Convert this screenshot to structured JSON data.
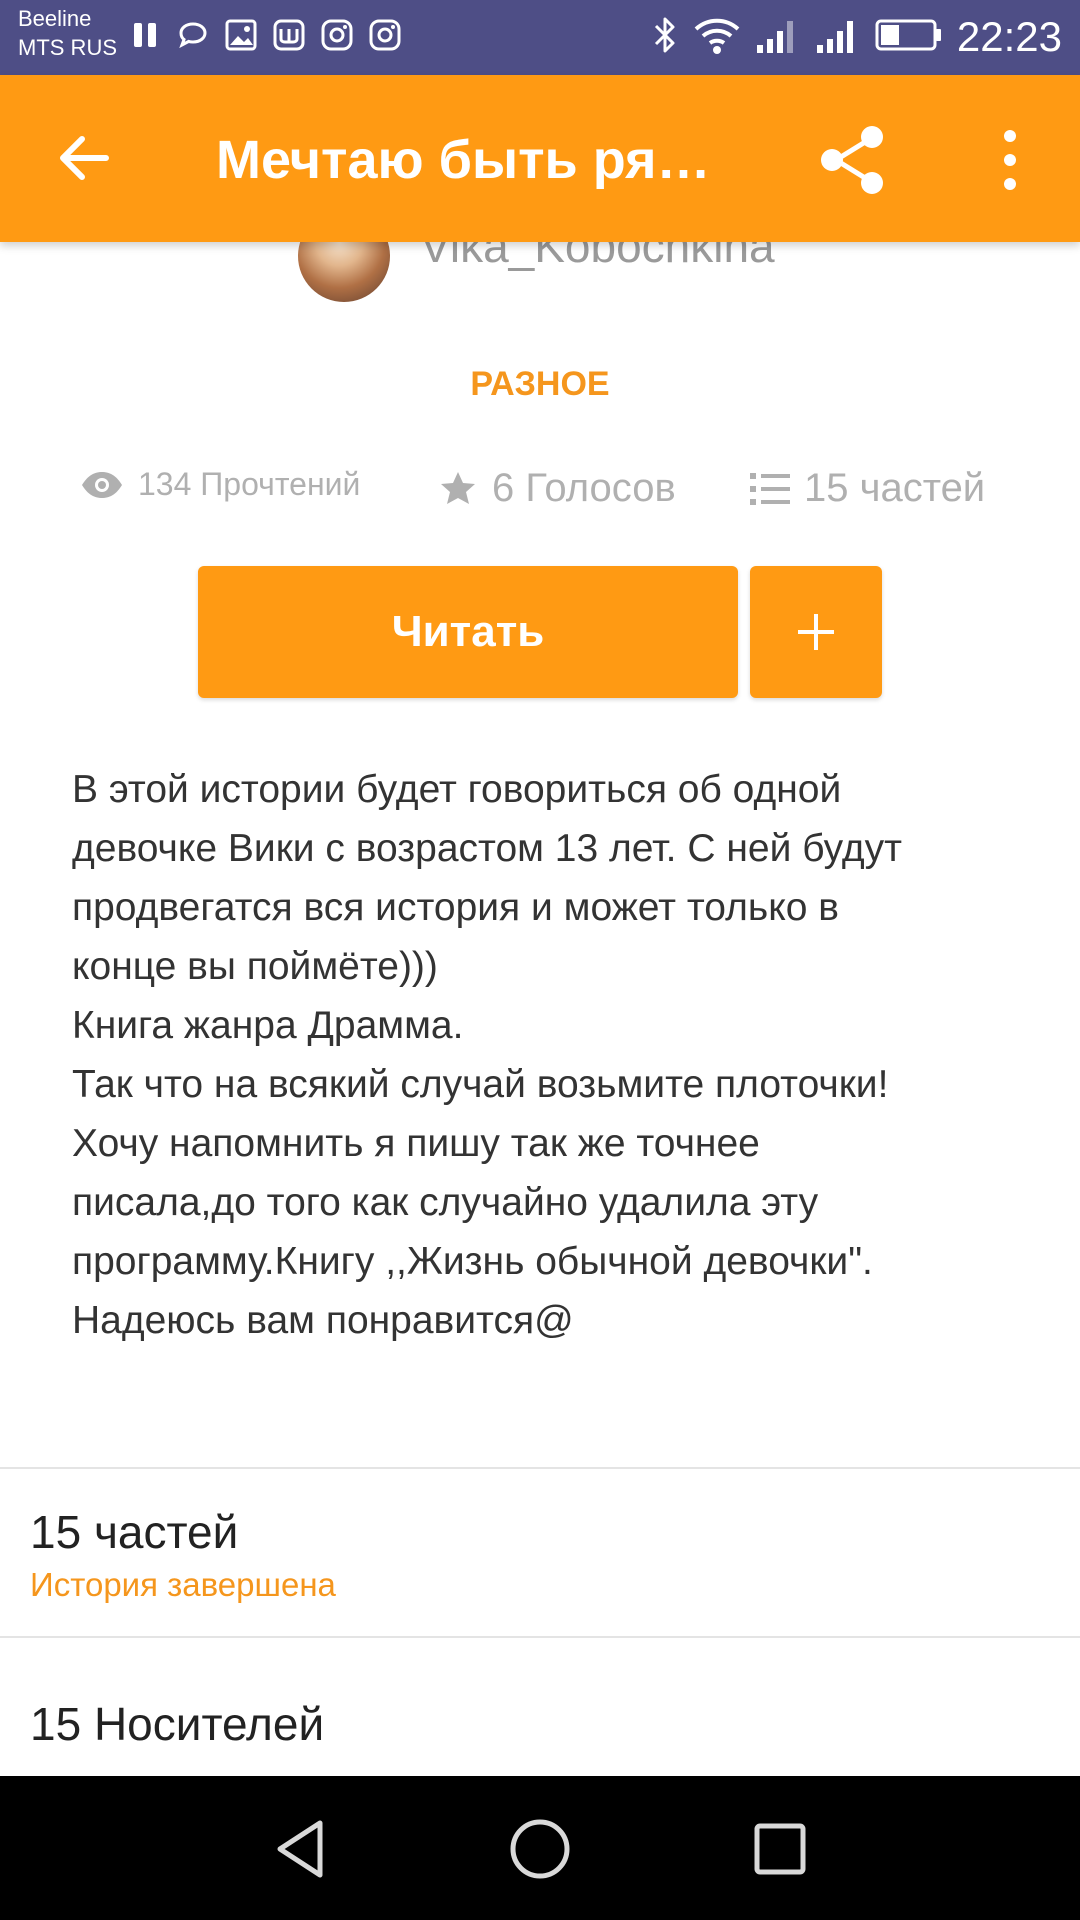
{
  "status_bar": {
    "carrier1": "Beeline",
    "carrier2": "MTS RUS",
    "time": "22:23",
    "left_icons": [
      "pause-icon",
      "chat-icon",
      "gallery-icon",
      "app-icon",
      "instagram-icon",
      "instagram-icon"
    ],
    "right_icons": [
      "bluetooth-icon",
      "wifi-icon",
      "signal-icon",
      "signal-icon",
      "battery-icon"
    ]
  },
  "app_bar": {
    "title": "Мечтаю быть ря…",
    "background": "#ff9a13"
  },
  "story": {
    "author": "Vika_Kobochkina",
    "category": "РАЗНОЕ",
    "stats": {
      "reads": "134 Прочтений",
      "votes": "6 Голосов",
      "parts": "15 частей"
    },
    "read_button": "Читать",
    "add_button": "+",
    "description": "В этой истории будет говориться об одной\nдевочке Вики с возрастом 13 лет. С ней будут\nпродвегатся вся история и может только в\nконце вы поймёте)))\nКнига жанра Драмма.\nТак что на всякий случай возьмите плоточки!\nХочу напомнить я пишу так же точнее\nписала,до того как случайно удалила эту\nпрограмму.Книгу ,,Жизнь обычной девочки\".\nНадеюсь вам понравится@"
  },
  "sections": {
    "parts_title": "15 частей",
    "parts_status": "История завершена",
    "media_title": "15 Носителей"
  },
  "colors": {
    "accent": "#ff9a13",
    "status_bar": "#4e4e86",
    "category_text": "#f5961d"
  }
}
